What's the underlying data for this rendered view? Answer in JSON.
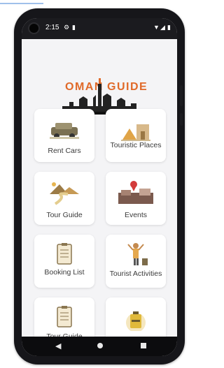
{
  "status_bar": {
    "time": "2:15",
    "left_icons": [
      "settings-icon",
      "sim-card-icon"
    ],
    "right_icons": [
      "wifi-icon",
      "signal-icon",
      "battery-icon"
    ]
  },
  "app": {
    "logo_left": "OMAN",
    "logo_right": "GUIDE",
    "brand_color": "#e06a2a"
  },
  "menu": [
    {
      "label": "Rent Cars",
      "icon": "car-icon"
    },
    {
      "label": "Touristic Places",
      "icon": "fort-icon"
    },
    {
      "label": "Tour Guide",
      "icon": "desert-path-icon"
    },
    {
      "label": "Events",
      "icon": "events-map-icon"
    },
    {
      "label": "Booking List",
      "icon": "clipboard-icon"
    },
    {
      "label": "Tourist Activities",
      "icon": "traveler-icon"
    },
    {
      "label": "Tour Guide",
      "icon": "clipboard-icon"
    },
    {
      "label": "",
      "icon": "luggage-icon"
    }
  ],
  "nav": {
    "back": "◀",
    "home": "home-button",
    "recents": "recents-button"
  }
}
